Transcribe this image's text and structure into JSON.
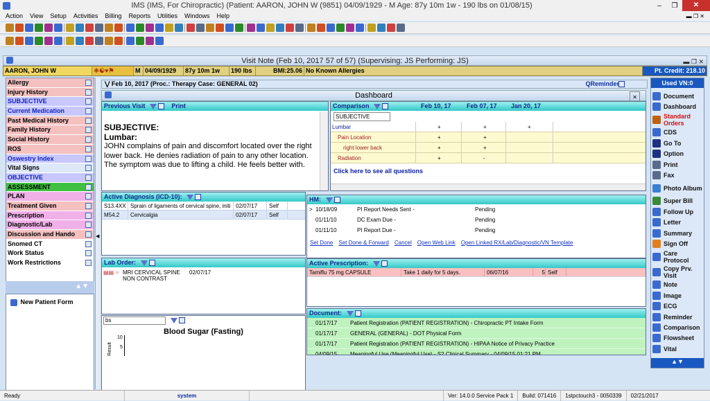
{
  "title": "IMS (IMS, For Chiropractic)    (Patient: AARON, JOHN W (9851) 04/09/1929 - M Age: 87y 10m 1w - 190 lbs on 01/08/15)",
  "menu": [
    "Action",
    "View",
    "Setup",
    "Activities",
    "Billing",
    "Reports",
    "Utilities",
    "Windows",
    "Help"
  ],
  "visitNoteTitle": "Visit Note (Feb 10, 2017   57 of 57) (Supervising: JS Performing: JS)",
  "patient": {
    "name": "AARON, JOHN W",
    "sex": "M",
    "dob": "04/09/1929",
    "age": "87y 10m 1w",
    "weight": "190 lbs",
    "bmi": "BMI:25.06",
    "allergies": "No Known Allergies",
    "credit": "Pt. Credit: 218.10",
    "usedVN": "Used VN:0"
  },
  "leftNav": [
    {
      "label": "Allergy",
      "bg": "#f4c0c0",
      "color": "#000"
    },
    {
      "label": "Injury History",
      "bg": "#f4c0c0",
      "color": "#000"
    },
    {
      "label": "SUBJECTIVE",
      "bg": "#c8c8ff",
      "color": "#1020c0"
    },
    {
      "label": "Current Medication",
      "bg": "#c8c8ff",
      "color": "#1020c0"
    },
    {
      "label": "Past Medical History",
      "bg": "#f4c0c0",
      "color": "#000"
    },
    {
      "label": "Family History",
      "bg": "#f4c0c0",
      "color": "#000"
    },
    {
      "label": "Social History",
      "bg": "#f4c0c0",
      "color": "#000"
    },
    {
      "label": "ROS",
      "bg": "#f4c0c0",
      "color": "#000"
    },
    {
      "label": "Oswestry Index",
      "bg": "#c8c8ff",
      "color": "#1020c0"
    },
    {
      "label": "Vital Signs",
      "bg": "#dde8f8",
      "color": "#000"
    },
    {
      "label": "OBJECTIVE",
      "bg": "#c8c8ff",
      "color": "#1020c0"
    },
    {
      "label": "ASSESSMENT",
      "bg": "#40c040",
      "color": "#000"
    },
    {
      "label": "PLAN",
      "bg": "#f0b0e8",
      "color": "#000"
    },
    {
      "label": "Treatment Given",
      "bg": "#f4c0c0",
      "color": "#000"
    },
    {
      "label": "Prescription",
      "bg": "#f0b0e8",
      "color": "#000"
    },
    {
      "label": "Diagnostic/Lab",
      "bg": "#f0b0e8",
      "color": "#000"
    },
    {
      "label": "Discussion and Hando",
      "bg": "#f4c0c0",
      "color": "#000"
    },
    {
      "label": "Snomed CT",
      "bg": "#fff",
      "color": "#000"
    },
    {
      "label": "Work Status",
      "bg": "#fff",
      "color": "#000"
    },
    {
      "label": "Work Restrictions",
      "bg": "#fff",
      "color": "#000"
    }
  ],
  "newPatientForm": "New Patient Form",
  "visitBar": {
    "text": "Feb 10, 2017  (Proc.: Therapy   Case: GENERAL 02)",
    "reminder": "QReminder"
  },
  "dashboard": "Dashboard",
  "prevVisit": {
    "label": "Previous Visit",
    "print": "Print",
    "heading": "SUBJECTIVE:",
    "subheading": "Lumbar:",
    "body": "JOHN complains of pain and discomfort located over the right lower back. He denies radiation of pain to any other location. The symptom was due to lifting a child.  He feels better with."
  },
  "comparison": {
    "label": "Comparison",
    "select": "SUBJECTIVE",
    "dates": [
      "Feb 10, 17",
      "Feb 07, 17",
      "Jan 20, 17"
    ],
    "rows": [
      {
        "label": "Lumbar",
        "marks": [
          "+",
          "+",
          "+"
        ],
        "indent": 0
      },
      {
        "label": "Pain Location",
        "marks": [
          "+",
          "+",
          ""
        ],
        "indent": 1
      },
      {
        "label": "right lower back",
        "marks": [
          "+",
          "+",
          ""
        ],
        "indent": 2
      },
      {
        "label": "Radiation",
        "marks": [
          "+",
          "-",
          ""
        ],
        "indent": 1
      }
    ],
    "seeAll": "Click here to see all questions"
  },
  "activeDx": {
    "label": "Active Diagnosis (ICD-10):",
    "rows": [
      {
        "code": "S13.4XX",
        "desc": "Sprain of ligaments of cervical spine, initi",
        "date": "02/07/17",
        "by": "Self"
      },
      {
        "code": "M54.2",
        "desc": "Cervicalgia",
        "date": "02/07/17",
        "by": "Self"
      }
    ]
  },
  "hm": {
    "label": "HM:",
    "rows": [
      {
        "date": "10/18/09",
        "item": "PI Report Needs Sent  -",
        "status": "Pending"
      },
      {
        "date": "01/11/10",
        "item": "DC Exam Due  -",
        "status": "Pending"
      },
      {
        "date": "01/11/10",
        "item": "PI Report Due  -",
        "status": "Pending"
      }
    ],
    "links": [
      "Set Done",
      "Set Done & Forward",
      "Cancel",
      "Open Web Link",
      "Open Linked RX/Lab/Diagnostic/VN Template"
    ]
  },
  "labOrder": {
    "label": "Lab Order:",
    "rows": [
      {
        "name": "MRI CERVICAL SPINE NON CONTRAST",
        "date": "02/07/17"
      }
    ]
  },
  "activeRx": {
    "label": "Active Prescription:",
    "rows": [
      {
        "drug": "Tamiflu 75 mg CAPSULE",
        "sig": "Take 1 daily for 5 days.",
        "date": "06/07/16",
        "qty": "5",
        "by": "Self"
      }
    ]
  },
  "documents": {
    "label": "Document:",
    "rows": [
      {
        "date": "01/17/17",
        "desc": "Patient Registration (PATIENT REGISTRATION)  - Chiropractic PT Intake Form"
      },
      {
        "date": "01/17/17",
        "desc": "GENERAL (GENERAL)  - DOT Physical Form"
      },
      {
        "date": "01/17/17",
        "desc": "Patient Registration (PATIENT REGISTRATION)  - HIPAA Notice of Privacy Practice"
      },
      {
        "date": "04/09/15",
        "desc": "Meaningful Use (Meaningful Use)  - S2 Clinical Summary - 04/09/15 01:21 PM"
      }
    ]
  },
  "bloodSugar": {
    "select": "bs",
    "title": "Blood Sugar (Fasting)",
    "ylabel": "Result",
    "ticks": [
      "10",
      "5"
    ]
  },
  "rightNav": [
    {
      "label": "Document",
      "color": "#111",
      "icon": "#3a6ad0"
    },
    {
      "label": "Dashboard",
      "color": "#111",
      "icon": "#3a6ad0"
    },
    {
      "label": "Standard Orders",
      "color": "#d01010",
      "icon": "#c06010"
    },
    {
      "label": "CDS",
      "color": "#111",
      "icon": "#3a6ad0"
    },
    {
      "label": "Go To",
      "color": "#111",
      "icon": "#203080"
    },
    {
      "label": "Option",
      "color": "#111",
      "icon": "#203080"
    },
    {
      "label": "Print",
      "color": "#111",
      "icon": "#5a6a8a"
    },
    {
      "label": "Fax",
      "color": "#111",
      "icon": "#5a6a8a"
    },
    {
      "label": "Photo Album",
      "color": "#111",
      "icon": "#3a80d0"
    },
    {
      "label": "Super Bill",
      "color": "#111",
      "icon": "#3a8a3a"
    },
    {
      "label": "Follow Up",
      "color": "#111",
      "icon": "#3a6ad0"
    },
    {
      "label": "Letter",
      "color": "#111",
      "icon": "#3a6ad0"
    },
    {
      "label": "Summary",
      "color": "#111",
      "icon": "#3a6ad0"
    },
    {
      "label": "Sign Off",
      "color": "#111",
      "icon": "#e08020"
    },
    {
      "label": "Care Protocol",
      "color": "#111",
      "icon": "#3a6ad0"
    },
    {
      "label": "Copy Prv. Visit",
      "color": "#111",
      "icon": "#3a6ad0"
    },
    {
      "label": "Note",
      "color": "#111",
      "icon": "#3a6ad0"
    },
    {
      "label": "Image",
      "color": "#111",
      "icon": "#3a6ad0"
    },
    {
      "label": "ECG",
      "color": "#111",
      "icon": "#3a6ad0"
    },
    {
      "label": "Reminder",
      "color": "#111",
      "icon": "#3a6ad0"
    },
    {
      "label": "Comparison",
      "color": "#111",
      "icon": "#3a6ad0"
    },
    {
      "label": "Flowsheet",
      "color": "#111",
      "icon": "#3a6ad0"
    },
    {
      "label": "Vital",
      "color": "#111",
      "icon": "#3a6ad0"
    }
  ],
  "status": {
    "ready": "Ready",
    "user": "system",
    "ver": "Ver: 14.0.0 Service Pack 1",
    "build": "Build: 071416",
    "station": "1stpctouch3 - 0050339",
    "date": "02/21/2017"
  }
}
